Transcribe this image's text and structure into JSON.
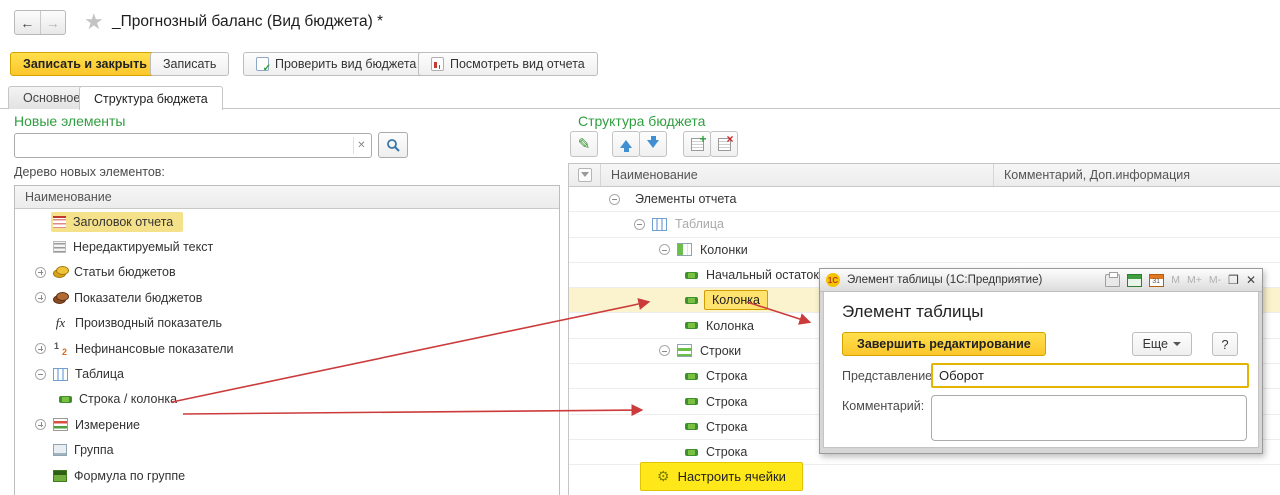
{
  "window": {
    "nav_title": "_Прогнозный баланс (Вид бюджета) *"
  },
  "toolbar": {
    "save_close": "Записать и закрыть",
    "save": "Записать",
    "check": "Проверить вид бюджета",
    "view_report": "Посмотреть вид отчета"
  },
  "tabs": [
    {
      "label": "Основное"
    },
    {
      "label": "Структура бюджета"
    }
  ],
  "left_panel": {
    "title": "Новые элементы",
    "tree_label": "Дерево новых элементов:",
    "header": "Наименование",
    "items": [
      {
        "label": "Заголовок отчета",
        "icon": "report-header-icon",
        "highlighted": true
      },
      {
        "label": "Нередактируемый текст",
        "icon": "static-text-icon"
      },
      {
        "label": "Статьи бюджетов",
        "icon": "budget-articles-icon",
        "expandable": true
      },
      {
        "label": "Показатели бюджетов",
        "icon": "budget-indicators-icon",
        "expandable": true
      },
      {
        "label": "Производный показатель",
        "icon": "fx-icon"
      },
      {
        "label": "Нефинансовые показатели",
        "icon": "nonfinancial-icon",
        "expandable": true
      },
      {
        "label": "Таблица",
        "icon": "table-icon",
        "expanded": true
      },
      {
        "label": "Строка / колонка",
        "icon": "row-column-icon",
        "child": true
      },
      {
        "label": "Измерение",
        "icon": "dimension-icon",
        "expandable": true
      },
      {
        "label": "Группа",
        "icon": "group-icon"
      },
      {
        "label": "Формула по группе",
        "icon": "group-formula-icon"
      }
    ]
  },
  "right_panel": {
    "title": "Структура бюджета",
    "columns": [
      "Наименование",
      "Комментарий, Доп.информация"
    ],
    "rows": [
      {
        "label": "Элементы отчета",
        "level": 1,
        "expanded": true
      },
      {
        "label": "Таблица",
        "level": 2,
        "expanded": true,
        "icon": "table-icon",
        "muted": true
      },
      {
        "label": "Колонки",
        "level": 3,
        "expanded": true,
        "icon": "columns-icon"
      },
      {
        "label": "Начальный остаток",
        "level": 4,
        "icon": "row-icon"
      },
      {
        "label": "Колонка",
        "level": 4,
        "icon": "row-icon",
        "selected": true
      },
      {
        "label": "Колонка",
        "level": 4,
        "icon": "row-icon"
      },
      {
        "label": "Строки",
        "level": 3,
        "expanded": true,
        "icon": "rows-icon"
      },
      {
        "label": "Строка",
        "level": 4,
        "icon": "row-icon"
      },
      {
        "label": "Строка",
        "level": 4,
        "icon": "row-icon"
      },
      {
        "label": "Строка",
        "level": 4,
        "icon": "row-icon"
      },
      {
        "label": "Строка",
        "level": 4,
        "icon": "row-icon"
      }
    ],
    "configure_cells": "Настроить ячейки"
  },
  "dialog": {
    "title": "Элемент таблицы  (1С:Предприятие)",
    "titlebar": {
      "calendar_day": "31",
      "m": "M",
      "m_plus": "M+",
      "m_minus": "M-"
    },
    "heading": "Элемент таблицы",
    "finish_button": "Завершить редактирование",
    "more_button": "Еще",
    "help_button": "?",
    "fields": {
      "presentation_label": "Представление:",
      "presentation_value": "Оборот",
      "comment_label": "Комментарий:",
      "comment_value": ""
    }
  },
  "colors": {
    "accent_yellow": "#fcc62c",
    "bright_yellow": "#ffe81a",
    "selection_yellow": "#fbf3cd",
    "green_title": "#2f9e3f",
    "arrow_red": "#cc3b3b"
  }
}
